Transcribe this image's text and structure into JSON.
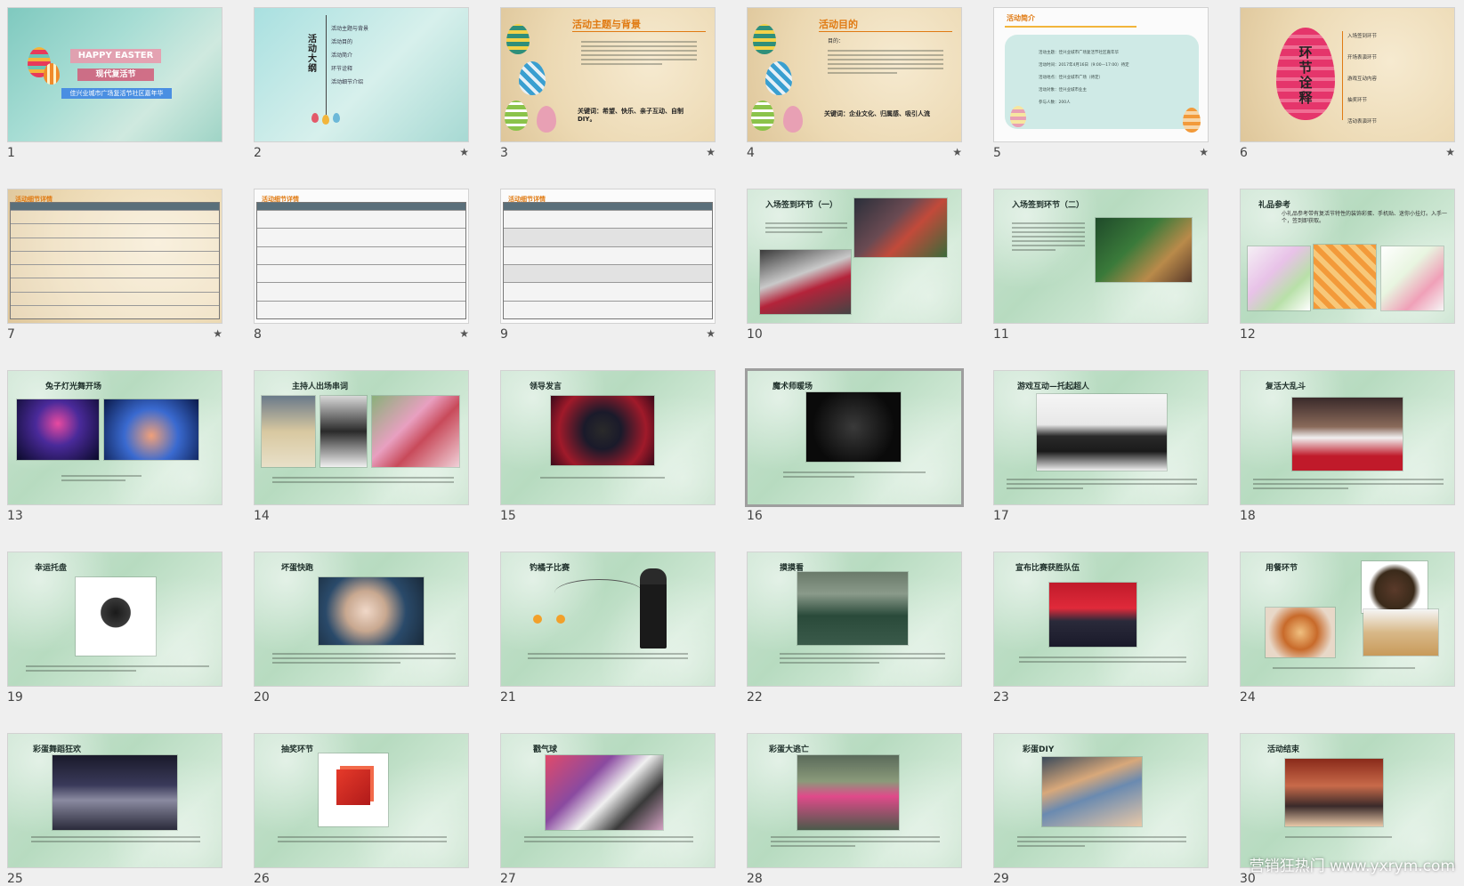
{
  "slides": [
    {
      "num": "1",
      "starred": false,
      "title": "HAPPY EASTER",
      "subtitle": "现代复活节",
      "banner": "佳兴业城市广场复活节社区嘉年华"
    },
    {
      "num": "2",
      "starred": true,
      "title": "活动大纲",
      "items": [
        "活动主题与背景",
        "活动目的",
        "活动简介",
        "环节诠释",
        "活动细节介绍"
      ]
    },
    {
      "num": "3",
      "starred": true,
      "title": "活动主题与背景",
      "keywords": "关键词：希望、快乐、亲子互动、自制DIY。"
    },
    {
      "num": "4",
      "starred": true,
      "title": "活动目的",
      "lead": "目的：",
      "keywords": "关键词：企业文化、归属感、吸引人流"
    },
    {
      "num": "5",
      "starred": true,
      "title": "活动简介",
      "items": [
        "活动主题：佳兴业城市广场复活节社区嘉年华",
        "活动时间：2017年4月16日（9:00—17:00）待定",
        "活动地点：佳兴业城市广场（待定）",
        "活动对象：佳兴业城市业主",
        "参与人数：200人"
      ]
    },
    {
      "num": "6",
      "starred": true,
      "title": "环节诠释",
      "items": [
        "入场签到环节",
        "开场表演环节",
        "游戏互动内容",
        "抽奖环节",
        "活动表演环节"
      ]
    },
    {
      "num": "7",
      "starred": true,
      "title": "活动细节详情"
    },
    {
      "num": "8",
      "starred": true,
      "title": "活动细节详情"
    },
    {
      "num": "9",
      "starred": true,
      "title": "活动细节详情"
    },
    {
      "num": "10",
      "starred": false,
      "title": "入场签到环节（一）"
    },
    {
      "num": "11",
      "starred": false,
      "title": "入场签到环节（二）"
    },
    {
      "num": "12",
      "starred": false,
      "title": "礼品参考",
      "lead": "小礼品参考带有复活节特性的装饰彩蛋、手机贴、迷你小挂灯。入手一个，签到即获取。"
    },
    {
      "num": "13",
      "starred": false,
      "title": "兔子灯光舞开场"
    },
    {
      "num": "14",
      "starred": false,
      "title": "主持人出场串词"
    },
    {
      "num": "15",
      "starred": false,
      "title": "领导发言"
    },
    {
      "num": "16",
      "starred": false,
      "title": "魔术师暖场",
      "selected": true
    },
    {
      "num": "17",
      "starred": false,
      "title": "游戏互动—托起超人"
    },
    {
      "num": "18",
      "starred": false,
      "title": "复活大乱斗"
    },
    {
      "num": "19",
      "starred": false,
      "title": "幸运托盘"
    },
    {
      "num": "20",
      "starred": false,
      "title": "坏蛋快跑"
    },
    {
      "num": "21",
      "starred": false,
      "title": "钓橘子比赛"
    },
    {
      "num": "22",
      "starred": false,
      "title": "摸摸看"
    },
    {
      "num": "23",
      "starred": false,
      "title": "宣布比赛获胜队伍"
    },
    {
      "num": "24",
      "starred": false,
      "title": "用餐环节"
    },
    {
      "num": "25",
      "starred": false,
      "title": "彩蛋舞蹈狂欢"
    },
    {
      "num": "26",
      "starred": false,
      "title": "抽奖环节"
    },
    {
      "num": "27",
      "starred": false,
      "title": "戳气球"
    },
    {
      "num": "28",
      "starred": false,
      "title": "彩蛋大逃亡"
    },
    {
      "num": "29",
      "starred": false,
      "title": "彩蛋DIY"
    },
    {
      "num": "30",
      "starred": false,
      "title": "活动结束"
    }
  ],
  "star_symbol": "★",
  "watermark": "营销狂热门 www.yxrym.com",
  "colors": {
    "selected_border": "#9e9e9e",
    "accent_orange": "#e07a12"
  }
}
